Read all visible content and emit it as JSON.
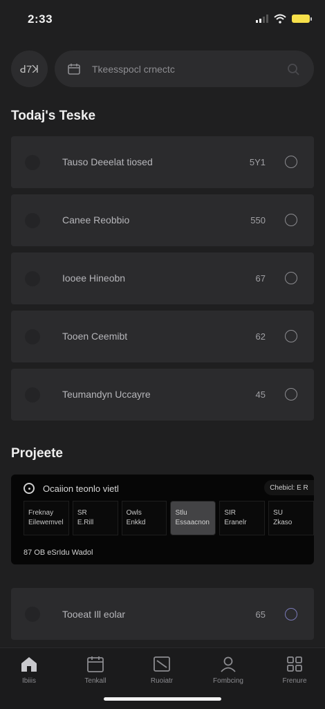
{
  "status": {
    "time": "2:33"
  },
  "header": {
    "avatar_text": "ꓒ7ꓘ",
    "search_placeholder": "Tkeesspocl crnectc"
  },
  "tasks_section": {
    "title": "Todaj's Teske",
    "items": [
      {
        "label": "Tauso Deeelat tiosed",
        "value": "5Y1"
      },
      {
        "label": "Canee Reobbio",
        "value": "550"
      },
      {
        "label": "Iooee Hineobn",
        "value": "67"
      },
      {
        "label": "Tooen Ceemibt",
        "value": "62"
      },
      {
        "label": "Teumandyn Uccayre",
        "value": "45"
      }
    ]
  },
  "projects_section": {
    "title": "Projeete",
    "card": {
      "title": "Ocaiion teonlo vietl",
      "pill_label": "Chebicl: E R",
      "cells": [
        {
          "top": "Freknay",
          "bottom": "Eilewemvel"
        },
        {
          "top": "SR",
          "bottom": "E.Rill"
        },
        {
          "top": "Owls",
          "bottom": "Enkkd"
        },
        {
          "top": "Stlu",
          "bottom": "Essaacnon"
        },
        {
          "top": "SIR",
          "bottom": "Eranelr"
        },
        {
          "top": "SU",
          "bottom": "Zkaso"
        }
      ],
      "footer": "87 OB eSrIdu Wadol"
    }
  },
  "extra_task": {
    "label": "Tooeat Ill eolar",
    "value": "65"
  },
  "tabbar": {
    "items": [
      {
        "label": "Ibiiis",
        "icon": "home-icon"
      },
      {
        "label": "Tenkall",
        "icon": "calendar-icon"
      },
      {
        "label": "Ruoiatr",
        "icon": "note-icon"
      },
      {
        "label": "Fombcing",
        "icon": "person-icon"
      },
      {
        "label": "Frenure",
        "icon": "grid-icon"
      }
    ]
  },
  "colors": {
    "background": "#1f1f20",
    "card": "#2b2b2d",
    "battery": "#f7e04a",
    "accent_check": "#7a7ab8"
  }
}
